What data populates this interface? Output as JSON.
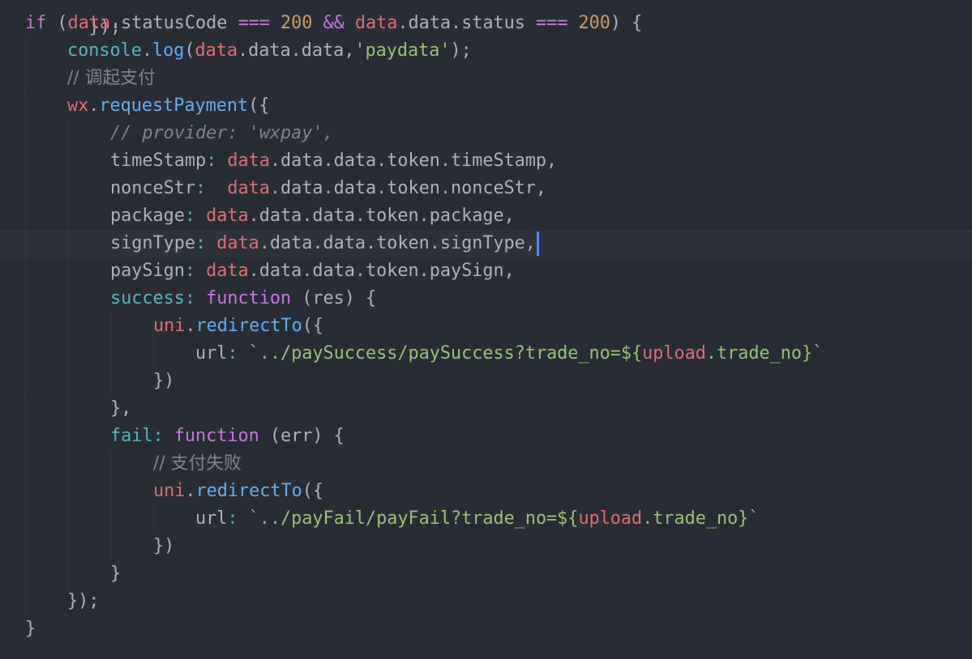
{
  "editor": {
    "theme_background": "#282c34",
    "active_line_background": "#2c313a",
    "cursor_color": "#528bff",
    "colors": {
      "keyword": "#c678dd",
      "variable": "#e06c75",
      "function": "#61afef",
      "number": "#d19a66",
      "string": "#98c379",
      "comment": "#7f848e",
      "operator": "#56b6c2",
      "text": "#abb2bf"
    },
    "lines": [
      {
        "text": "});"
      },
      {
        "text": "if (data.statusCode === 200 && data.data.status === 200) {"
      },
      {
        "text": "console.log(data.data.data,'paydata');"
      },
      {
        "text": "// 调起支付"
      },
      {
        "text": "wx.requestPayment({"
      },
      {
        "text": "// provider: 'wxpay',"
      },
      {
        "text": "timeStamp: data.data.data.token.timeStamp,"
      },
      {
        "text": "nonceStr:  data.data.data.token.nonceStr,"
      },
      {
        "text": "package: data.data.data.token.package,"
      },
      {
        "text": "signType: data.data.data.token.signType,"
      },
      {
        "text": "paySign: data.data.data.token.paySign,"
      },
      {
        "text": "success: function (res) {"
      },
      {
        "text": "uni.redirectTo({"
      },
      {
        "text": "url: `../paySuccess/paySuccess?trade_no=${upload.trade_no}`"
      },
      {
        "text": "})"
      },
      {
        "text": "},"
      },
      {
        "text": "fail: function (err) {"
      },
      {
        "text": "// 支付失败"
      },
      {
        "text": "uni.redirectTo({"
      },
      {
        "text": "url: `../payFail/payFail?trade_no=${upload.trade_no}`"
      },
      {
        "text": "})"
      },
      {
        "text": "}"
      },
      {
        "text": "});"
      },
      {
        "text": "}"
      }
    ],
    "tokens": {
      "l0": [
        "});"
      ],
      "l1": [
        "if",
        " (",
        "data",
        ".statusCode ",
        "===",
        " ",
        "200",
        " ",
        "&&",
        " ",
        "data",
        ".data.status ",
        "===",
        " ",
        "200",
        ") {"
      ],
      "l2": [
        "console",
        ".",
        "log",
        "(",
        "data",
        ".data.data,",
        "'paydata'",
        ");"
      ],
      "l3": [
        "// 调起支付"
      ],
      "l4": [
        "wx",
        ".",
        "requestPayment",
        "({"
      ],
      "l5": [
        "// provider: 'wxpay',"
      ],
      "l6": [
        "timeStamp",
        ": ",
        "data",
        ".data.data.token.timeStamp,"
      ],
      "l7": [
        "nonceStr",
        ":  ",
        "data",
        ".data.data.token.nonceStr,"
      ],
      "l8": [
        "package",
        ": ",
        "data",
        ".data.data.token.package,"
      ],
      "l9": [
        "signType",
        ": ",
        "data",
        ".data.data.token.signType,"
      ],
      "l10": [
        "paySign",
        ": ",
        "data",
        ".data.data.token.paySign,"
      ],
      "l11": [
        "success",
        ": ",
        "function",
        " (res) {"
      ],
      "l12": [
        "uni",
        ".",
        "redirectTo",
        "({"
      ],
      "l13": [
        "url",
        ": ",
        "`../paySuccess/paySuccess?trade_no=${",
        "upload",
        ".trade_no",
        "}`"
      ],
      "l14": [
        "})"
      ],
      "l15": [
        "},"
      ],
      "l16": [
        "fail",
        ": ",
        "function",
        " (err) {"
      ],
      "l17": [
        "// 支付失败"
      ],
      "l18": [
        "uni",
        ".",
        "redirectTo",
        "({"
      ],
      "l19": [
        "url",
        ": ",
        "`../payFail/payFail?trade_no=${",
        "upload",
        ".trade_no",
        "}`"
      ],
      "l20": [
        "})"
      ],
      "l21": [
        "}"
      ],
      "l22": [
        "});"
      ],
      "l23": [
        "}"
      ]
    }
  }
}
